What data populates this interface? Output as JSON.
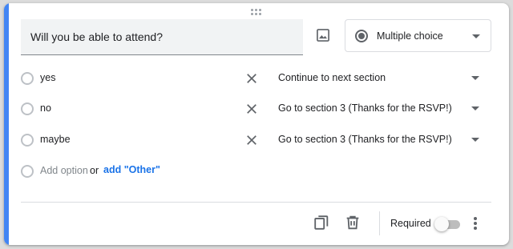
{
  "question": {
    "title": "Will you be able to attend?",
    "type_label": "Multiple choice"
  },
  "options": [
    {
      "label": "yes",
      "go_to": "Continue to next section"
    },
    {
      "label": "no",
      "go_to": "Go to section 3 (Thanks for the RSVP!)"
    },
    {
      "label": "maybe",
      "go_to": "Go to section 3 (Thanks for the RSVP!)"
    }
  ],
  "add_row": {
    "add_option_label": "Add option",
    "or_label": "or",
    "add_other_label": "add \"Other\""
  },
  "footer": {
    "required_label": "Required",
    "required_on": false
  },
  "icons": {
    "drag": "drag-handle-icon",
    "image": "image-icon",
    "type": "radio-button-checked-icon",
    "remove": "close-icon",
    "dropdown": "arrow-drop-down-icon",
    "duplicate": "content-copy-icon",
    "delete": "delete-icon",
    "more": "more-vert-icon"
  },
  "colors": {
    "accent": "#4285f4",
    "link": "#1a73e8",
    "field_bg": "#f1f3f4"
  }
}
